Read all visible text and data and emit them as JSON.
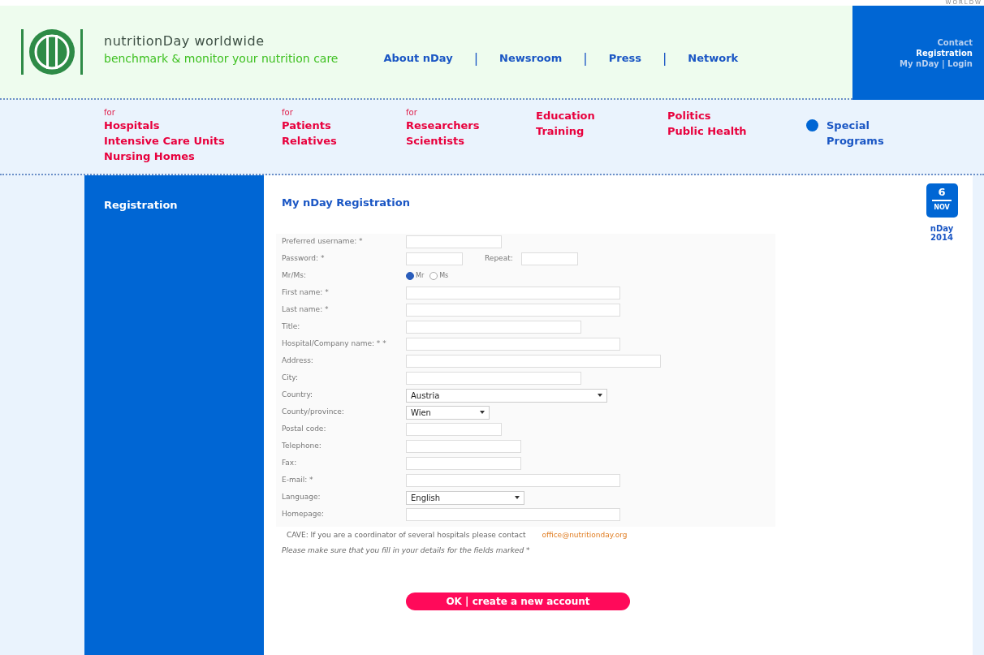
{
  "corner_text": "WORLDW",
  "header": {
    "title": "nutritionDay worldwide",
    "tagline": "benchmark & monitor your nutrition care",
    "links": [
      {
        "label": "About nDay"
      },
      {
        "label": "Newsroom"
      },
      {
        "label": "Press"
      },
      {
        "label": "Network"
      }
    ],
    "separators": [
      "|",
      "|",
      "|"
    ],
    "account_links": [
      {
        "label": "Contact",
        "selected": false
      },
      {
        "label": "Registration",
        "selected": true
      },
      {
        "label": "My nDay | Login",
        "selected": false
      }
    ]
  },
  "audience_nav": [
    {
      "prefix": "for",
      "lines": [
        "Hospitals",
        "Intensive Care Units",
        "Nursing Homes"
      ],
      "kind": "audience"
    },
    {
      "prefix": "for",
      "lines": [
        "Patients",
        "Relatives"
      ],
      "kind": "audience"
    },
    {
      "prefix": "for",
      "lines": [
        "Researchers",
        "Scientists"
      ],
      "kind": "audience"
    },
    {
      "lines": [
        "Education",
        "Training"
      ],
      "kind": "audience"
    },
    {
      "lines": [
        "Politics",
        "Public Health"
      ],
      "kind": "audience"
    },
    {
      "lines": [
        "Special",
        "Programs"
      ],
      "kind": "special"
    }
  ],
  "sidebar": {
    "items": [
      {
        "label": "Registration",
        "selected": true
      }
    ]
  },
  "form": {
    "heading": "My nDay Registration",
    "rows": [
      {
        "label": "Preferred username: *",
        "kind": "text"
      },
      {
        "label": "Password: *",
        "kind": "pair",
        "second_label": "Repeat:"
      },
      {
        "label": "Mr/Ms:",
        "kind": "radio",
        "options": [
          {
            "label": "Mr",
            "selected": true
          },
          {
            "label": "Ms",
            "selected": false
          }
        ]
      },
      {
        "label": "First name: *",
        "kind": "text"
      },
      {
        "label": "Last name: *",
        "kind": "text"
      },
      {
        "label": "Title:",
        "kind": "text"
      },
      {
        "label": "Hospital/Company name: * *",
        "kind": "text"
      },
      {
        "label": "Address:",
        "kind": "text"
      },
      {
        "label": "City:",
        "kind": "text"
      },
      {
        "label": "Country:",
        "kind": "select",
        "value": "Austria"
      },
      {
        "label": "County/province:",
        "kind": "select",
        "value": "Wien"
      },
      {
        "label": "Postal code:",
        "kind": "text"
      },
      {
        "label": "Telephone:",
        "kind": "text"
      },
      {
        "label": "Fax:",
        "kind": "text"
      },
      {
        "label": "E-mail: *",
        "kind": "text"
      },
      {
        "label": "Language:",
        "kind": "select",
        "value": "English"
      },
      {
        "label": "Homepage:",
        "kind": "text"
      }
    ],
    "note": "CAVE: If you are a coordinator of several hospitals please contact",
    "email_link": "office@nutritionday.org",
    "hint": "Please make sure that you fill in your details for the fields marked *",
    "submit": "OK | create a new account"
  },
  "date_badge": {
    "day": "6",
    "month": "NOV",
    "caption": [
      "nDay",
      "2014"
    ]
  }
}
